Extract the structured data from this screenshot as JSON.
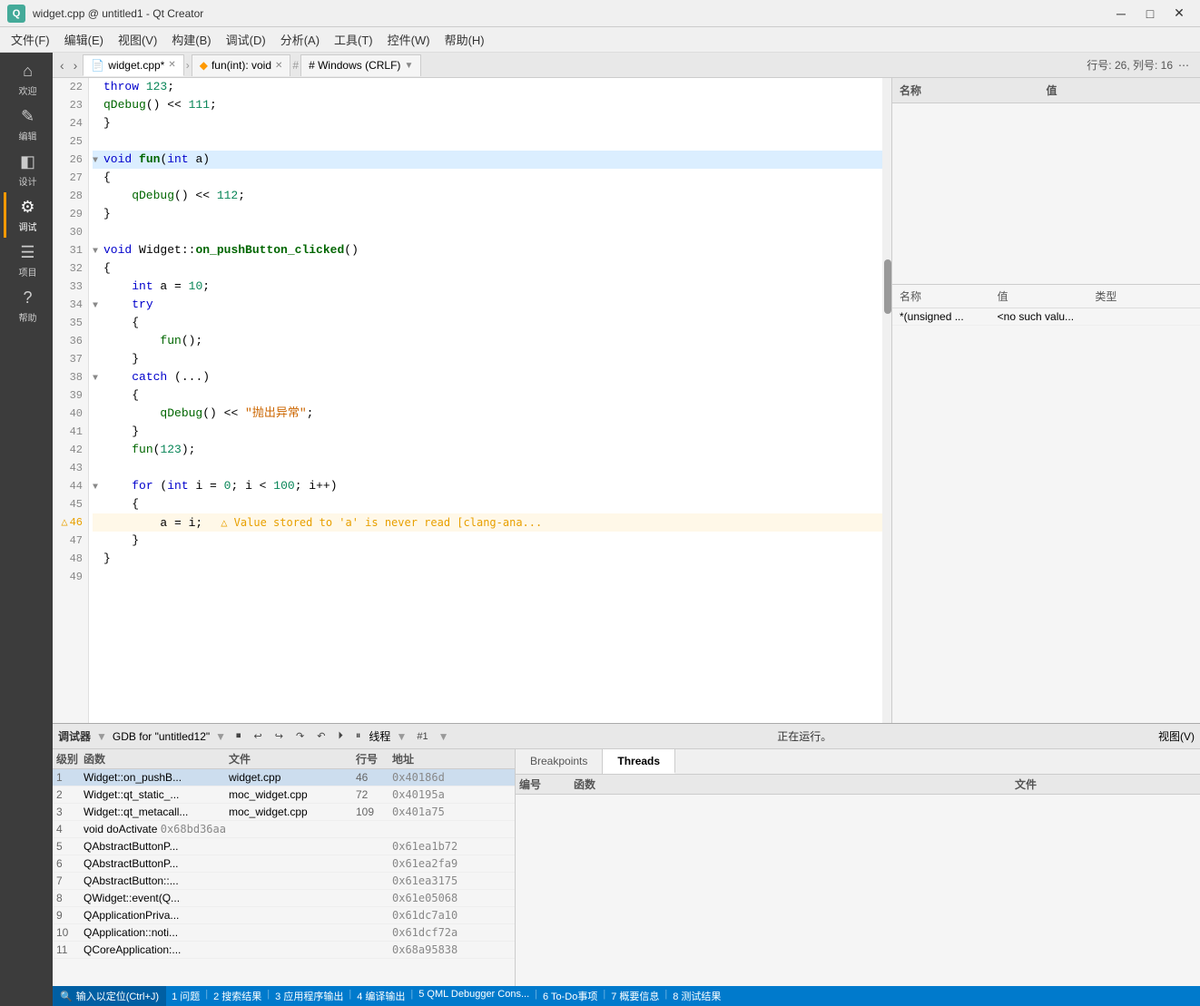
{
  "titlebar": {
    "app_icon": "Q",
    "title": "widget.cpp @ untitled1 - Qt Creator",
    "min_label": "─",
    "max_label": "□",
    "close_label": "✕"
  },
  "menubar": {
    "items": [
      "文件(F)",
      "编辑(E)",
      "视图(V)",
      "构建(B)",
      "调试(D)",
      "分析(A)",
      "工具(T)",
      "控件(W)",
      "帮助(H)"
    ]
  },
  "sidebar": {
    "items": [
      {
        "id": "welcome",
        "icon": "⌂",
        "label": "欢迎"
      },
      {
        "id": "edit",
        "icon": "✎",
        "label": "编辑"
      },
      {
        "id": "design",
        "icon": "◧",
        "label": "设计"
      },
      {
        "id": "debug",
        "icon": "⚙",
        "label": "调试",
        "active": true
      },
      {
        "id": "project",
        "icon": "☰",
        "label": "项目"
      },
      {
        "id": "help",
        "icon": "?",
        "label": "帮助"
      }
    ]
  },
  "tabs": [
    {
      "id": "widget-cpp",
      "icon": "📄",
      "label": "widget.cpp*",
      "active": true
    },
    {
      "id": "fun-int",
      "icon": "◆",
      "label": "fun(int): void",
      "breadcrumb": true
    },
    {
      "id": "encoding",
      "label": "# Windows (CRLF)"
    }
  ],
  "tab_info": {
    "line": "行号: 26",
    "col": "列号: 16"
  },
  "code": {
    "lines": [
      {
        "num": "22",
        "content": "    throw 123;",
        "tokens": [
          {
            "t": "kw",
            "v": "throw"
          },
          {
            "t": "",
            "v": " "
          },
          {
            "t": "num",
            "v": "123"
          },
          {
            "t": "",
            "v": ";"
          }
        ]
      },
      {
        "num": "23",
        "content": "    qDebug() << 111;",
        "tokens": [
          {
            "t": "fn2",
            "v": "qDebug"
          },
          {
            "t": "",
            "v": "() << "
          },
          {
            "t": "num",
            "v": "111"
          },
          {
            "t": "",
            "v": ";"
          }
        ]
      },
      {
        "num": "24",
        "content": "}",
        "tokens": [
          {
            "t": "",
            "v": "}"
          }
        ]
      },
      {
        "num": "25",
        "content": "",
        "tokens": []
      },
      {
        "num": "26",
        "content": "void fun(int a)",
        "highlight": true,
        "fold": true,
        "tokens": [
          {
            "t": "kw2",
            "v": "void"
          },
          {
            "t": "",
            "v": " "
          },
          {
            "t": "fn",
            "v": "fun"
          },
          {
            "t": "",
            "v": "("
          },
          {
            "t": "kw",
            "v": "int"
          },
          {
            "t": "",
            "v": " a)"
          }
        ]
      },
      {
        "num": "27",
        "content": "{",
        "tokens": [
          {
            "t": "",
            "v": "{"
          }
        ]
      },
      {
        "num": "28",
        "content": "    qDebug() << 112;",
        "tokens": [
          {
            "t": "fn2",
            "v": "    qDebug"
          },
          {
            "t": "",
            "v": "() << "
          },
          {
            "t": "num",
            "v": "112"
          },
          {
            "t": "",
            "v": ";"
          }
        ]
      },
      {
        "num": "29",
        "content": "}",
        "tokens": [
          {
            "t": "",
            "v": "}"
          }
        ]
      },
      {
        "num": "30",
        "content": "",
        "tokens": []
      },
      {
        "num": "31",
        "content": "void Widget::on_pushButton_clicked()",
        "fold": true,
        "tokens": [
          {
            "t": "kw2",
            "v": "void"
          },
          {
            "t": "",
            "v": " Widget::"
          },
          {
            "t": "fn",
            "v": "on_pushButton_clicked"
          },
          {
            "t": "",
            "v": "()"
          }
        ]
      },
      {
        "num": "32",
        "content": "{",
        "tokens": [
          {
            "t": "",
            "v": "{"
          }
        ]
      },
      {
        "num": "33",
        "content": "    int a = 10;",
        "tokens": [
          {
            "t": "",
            "v": "    "
          },
          {
            "t": "kw",
            "v": "int"
          },
          {
            "t": "",
            "v": " a = "
          },
          {
            "t": "num",
            "v": "10"
          },
          {
            "t": "",
            "v": ";"
          }
        ]
      },
      {
        "num": "34",
        "content": "    try",
        "fold": true,
        "tokens": [
          {
            "t": "",
            "v": "    "
          },
          {
            "t": "kw",
            "v": "try"
          }
        ]
      },
      {
        "num": "35",
        "content": "    {",
        "tokens": [
          {
            "t": "",
            "v": "    {"
          }
        ]
      },
      {
        "num": "36",
        "content": "        fun();",
        "tokens": [
          {
            "t": "",
            "v": "        "
          },
          {
            "t": "fn2",
            "v": "fun"
          },
          {
            "t": "",
            "v": "();"
          }
        ]
      },
      {
        "num": "37",
        "content": "    }",
        "tokens": [
          {
            "t": "",
            "v": "    }"
          }
        ]
      },
      {
        "num": "38",
        "content": "    catch (...)",
        "fold": true,
        "tokens": [
          {
            "t": "",
            "v": "    "
          },
          {
            "t": "kw",
            "v": "catch"
          },
          {
            "t": "",
            "v": " (...)"
          }
        ]
      },
      {
        "num": "39",
        "content": "    {",
        "tokens": [
          {
            "t": "",
            "v": "    {"
          }
        ]
      },
      {
        "num": "40",
        "content": "        qDebug() << \"抛出异常\";",
        "tokens": [
          {
            "t": "",
            "v": "        "
          },
          {
            "t": "fn2",
            "v": "qDebug"
          },
          {
            "t": "",
            "v": "() << "
          },
          {
            "t": "str",
            "v": "\"抛出异常\""
          },
          {
            "t": "",
            "v": ";"
          }
        ]
      },
      {
        "num": "41",
        "content": "    }",
        "tokens": [
          {
            "t": "",
            "v": "    }"
          }
        ]
      },
      {
        "num": "42",
        "content": "    fun(123);",
        "tokens": [
          {
            "t": "",
            "v": "    "
          },
          {
            "t": "fn2",
            "v": "fun"
          },
          {
            "t": "",
            "v": "("
          },
          {
            "t": "num",
            "v": "123"
          },
          {
            "t": "",
            "v": ");"
          }
        ]
      },
      {
        "num": "43",
        "content": "",
        "tokens": []
      },
      {
        "num": "44",
        "content": "    for (int i = 0; i < 100; i++)",
        "fold": true,
        "tokens": [
          {
            "t": "",
            "v": "    "
          },
          {
            "t": "kw",
            "v": "for"
          },
          {
            "t": "",
            "v": " ("
          },
          {
            "t": "kw",
            "v": "int"
          },
          {
            "t": "",
            "v": " i = "
          },
          {
            "t": "num",
            "v": "0"
          },
          {
            "t": "",
            "v": "; i < "
          },
          {
            "t": "num",
            "v": "100"
          },
          {
            "t": "",
            "v": "; i++)"
          }
        ]
      },
      {
        "num": "45",
        "content": "    {",
        "tokens": [
          {
            "t": "",
            "v": "    {"
          }
        ]
      },
      {
        "num": "46",
        "content": "        a = i;",
        "warn": true,
        "warn_msg": "△ Value stored to 'a' is never read [clang-ana...",
        "tokens": [
          {
            "t": "",
            "v": "        a = i;"
          }
        ]
      },
      {
        "num": "47",
        "content": "    }",
        "tokens": [
          {
            "t": "",
            "v": "    }"
          }
        ]
      },
      {
        "num": "48",
        "content": "}",
        "tokens": [
          {
            "t": "",
            "v": "}"
          }
        ]
      },
      {
        "num": "49",
        "content": "",
        "tokens": []
      }
    ]
  },
  "right_panel": {
    "watch_header": "名称",
    "watch_val_header": "值",
    "locals_header": "名称",
    "locals_val_header": "值",
    "locals_type_header": "类型",
    "locals_row": {
      "name": "*(unsigned ...",
      "value": "<no such valu...",
      "type": ""
    }
  },
  "debug_toolbar": {
    "label": "调试器",
    "debugger_name": "GDB for \"untitled12\"",
    "thread_label": "线程",
    "thread_num": "#1",
    "status": "正在运行。",
    "view_label": "视图(V)"
  },
  "call_stack": {
    "headers": [
      "级别",
      "函数",
      "文件",
      "行号",
      "地址"
    ],
    "rows": [
      {
        "level": "1",
        "func": "Widget::on_pushB...",
        "file": "widget.cpp",
        "line": "46",
        "addr": "0x40186d"
      },
      {
        "level": "2",
        "func": "Widget::qt_static_...",
        "file": "moc_widget.cpp",
        "line": "72",
        "addr": "0x40195a"
      },
      {
        "level": "3",
        "func": "Widget::qt_metacall...",
        "file": "moc_widget.cpp",
        "line": "109",
        "addr": "0x401a75"
      },
      {
        "level": "4",
        "func": "void doActivate <f...",
        "file": "",
        "line": "",
        "addr": "0x68bd36aa"
      },
      {
        "level": "5",
        "func": "QAbstractButtonP...",
        "file": "",
        "line": "",
        "addr": "0x61ea1b72"
      },
      {
        "level": "6",
        "func": "QAbstractButtonP...",
        "file": "",
        "line": "",
        "addr": "0x61ea2fa9"
      },
      {
        "level": "7",
        "func": "QAbstractButton::...",
        "file": "",
        "line": "",
        "addr": "0x61ea3175"
      },
      {
        "level": "8",
        "func": "QWidget::event(Q...",
        "file": "",
        "line": "",
        "addr": "0x61e05068"
      },
      {
        "level": "9",
        "func": "QApplicationPriva...",
        "file": "",
        "line": "",
        "addr": "0x61dc7a10"
      },
      {
        "level": "10",
        "func": "QApplication::noti...",
        "file": "",
        "line": "",
        "addr": "0x61dcf72a"
      },
      {
        "level": "11",
        "func": "QCoreApplication:...",
        "file": "",
        "line": "",
        "addr": "0x68a95838"
      }
    ]
  },
  "threads_panel": {
    "tabs": [
      "Breakpoints",
      "Threads"
    ],
    "active_tab": "Threads",
    "headers": [
      "编号",
      "函数",
      "文件"
    ]
  },
  "statusbar": {
    "search_placeholder": "输入以定位(Ctrl+J)",
    "items": [
      "1 问题",
      "2 搜索结果",
      "3 应用程序输出",
      "4 编译输出",
      "5 QML Debugger Cons...",
      "6 To-Do事项",
      "7 概要信息",
      "8 测试结果"
    ]
  },
  "app_title": "widget.cpp @ untitled1 - Qt Creator"
}
